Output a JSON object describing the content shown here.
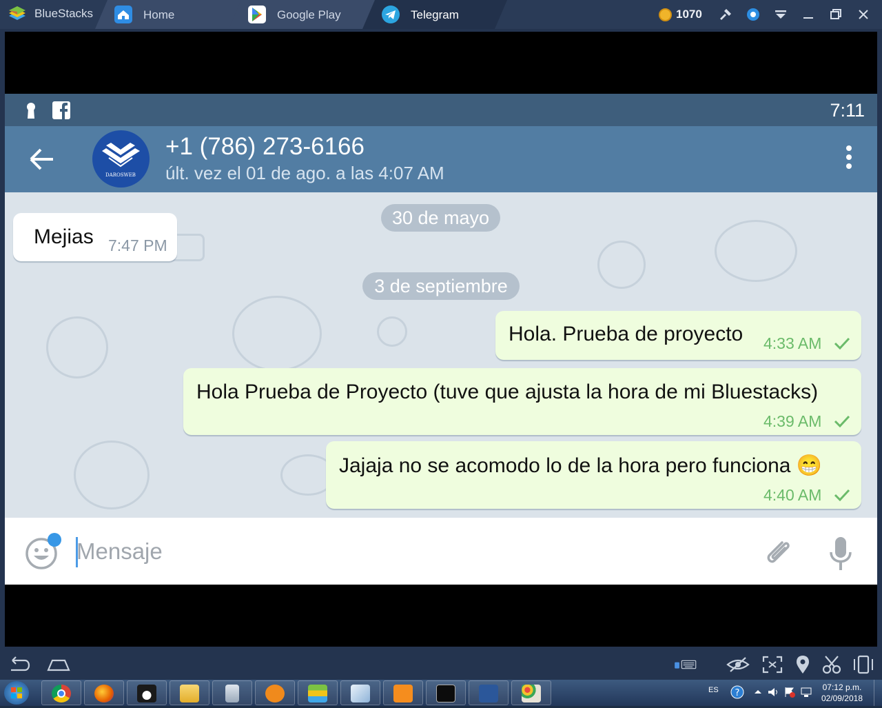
{
  "window": {
    "app_name": "BlueStacks",
    "tabs": [
      {
        "label": "Home",
        "icon": "home-icon",
        "color": "#2f8de4"
      },
      {
        "label": "Google Play",
        "icon": "google-play-icon",
        "color": "#ffffff"
      },
      {
        "label": "Telegram",
        "icon": "telegram-icon",
        "color": "#2ca5e0"
      }
    ],
    "active_tab": "Telegram",
    "coins": "1070",
    "toolbar_icons": [
      "hammer-icon",
      "location-pin-icon",
      "dropdown-icon",
      "minimize-icon",
      "restore-icon",
      "close-icon"
    ]
  },
  "android": {
    "status_time": "7:11",
    "status_icons": [
      "keyhole-icon",
      "facebook-icon"
    ],
    "chat": {
      "contact_name": "+1 (786) 273-6166",
      "last_seen": "últ. vez el 01 de ago. a las 4:07 AM",
      "avatar_text": "DAROSWEB"
    },
    "messages": [
      {
        "type": "date",
        "text": "30 de mayo"
      },
      {
        "type": "in",
        "text": "Mejias",
        "time": "7:47 PM"
      },
      {
        "type": "date",
        "text": "3 de septiembre"
      },
      {
        "type": "out",
        "text": "Hola. Prueba de proyecto",
        "time": "4:33 AM",
        "status": "sent"
      },
      {
        "type": "out",
        "text": "Hola Prueba de Proyecto (tuve que ajusta la hora de mi Bluestacks)",
        "time": "4:39 AM",
        "status": "sent"
      },
      {
        "type": "out",
        "text": "Jajaja no se acomodo lo de la hora pero funciona 😁",
        "time": "4:40 AM",
        "status": "sent"
      }
    ],
    "input": {
      "placeholder": "Mensaje",
      "icons": [
        "emoji-icon",
        "attach-icon",
        "microphone-icon"
      ]
    }
  },
  "bottom_bar": {
    "icons": [
      "back-icon",
      "home-icon",
      "keyboard-icon",
      "eye-icon",
      "fullscreen-icon",
      "location-icon",
      "scissors-icon",
      "rotate-device-icon"
    ]
  },
  "taskbar": {
    "apps": [
      "chrome",
      "firefox",
      "penguin",
      "file-explorer",
      "calculator",
      "media-player",
      "bluestacks",
      "notes",
      "sublime-text",
      "command-prompt",
      "word",
      "paint"
    ],
    "language": "ES",
    "time": "07:12 p.m.",
    "date": "02/09/2018"
  },
  "colors": {
    "header": "#527da3",
    "statusbar": "#3e5e7c",
    "outgoing_bubble": "#effdde",
    "time_green": "#6bbb6a"
  }
}
